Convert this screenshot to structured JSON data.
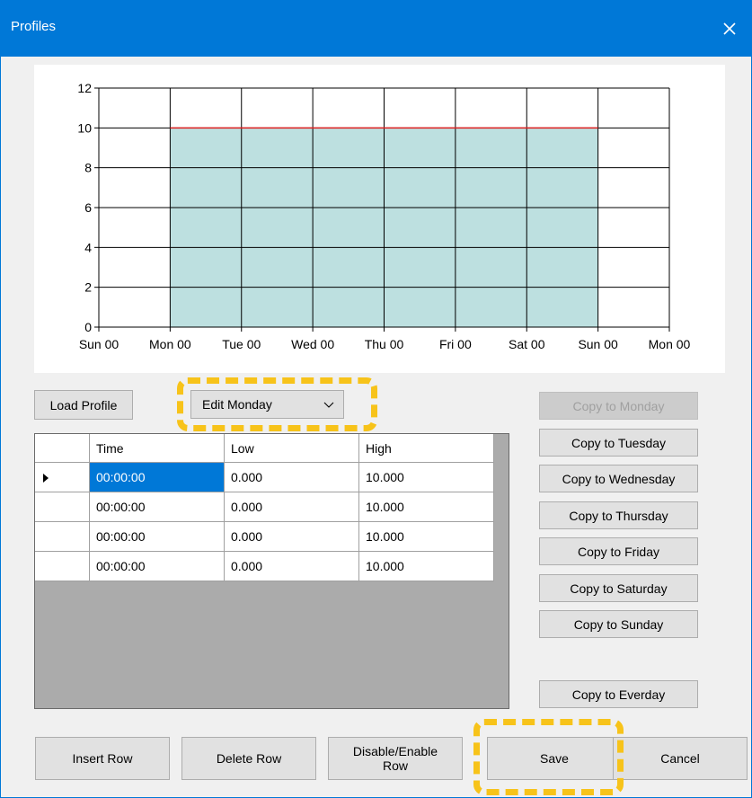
{
  "window": {
    "title": "Profiles",
    "close_icon": "close-icon",
    "title_bar_color": "#0078d7"
  },
  "chart_data": {
    "type": "area",
    "x": [
      "Sun 00",
      "Mon 00",
      "Tue 00",
      "Wed 00",
      "Thu 00",
      "Fri 00",
      "Sat 00",
      "Sun 00",
      "Mon 00"
    ],
    "ylim": [
      0,
      12
    ],
    "yticks": [
      "0",
      "2",
      "4",
      "6",
      "8",
      "10",
      "12"
    ],
    "grid": true,
    "series": [
      {
        "low": [
          null,
          0,
          0,
          0,
          0,
          0,
          0,
          0,
          null
        ],
        "high": [
          null,
          10,
          10,
          10,
          10,
          10,
          10,
          10,
          null
        ]
      }
    ],
    "fill_color": "#bde0e0",
    "line_color": "#e02020"
  },
  "controls": {
    "load_profile": "Load Profile",
    "edit_day": "Edit Monday"
  },
  "table": {
    "columns": [
      "Time",
      "Low",
      "High"
    ],
    "rows": [
      [
        "00:00:00",
        "0.000",
        "10.000"
      ],
      [
        "00:00:00",
        "0.000",
        "10.000"
      ],
      [
        "00:00:00",
        "0.000",
        "10.000"
      ],
      [
        "00:00:00",
        "0.000",
        "10.000"
      ]
    ]
  },
  "copy_buttons": {
    "monday": "Copy to Monday",
    "tuesday": "Copy to Tuesday",
    "wednesday": "Copy to Wednesday",
    "thursday": "Copy to Thursday",
    "friday": "Copy to Friday",
    "saturday": "Copy to Saturday",
    "sunday": "Copy to Sunday",
    "everyday": "Copy to Everday"
  },
  "bottom_buttons": {
    "insert_row": "Insert Row",
    "delete_row": "Delete Row",
    "disable_enable_line1": "Disable/Enable",
    "disable_enable_line2": "Row",
    "save": "Save",
    "cancel": "Cancel"
  },
  "highlight_color": "#f7c31a"
}
